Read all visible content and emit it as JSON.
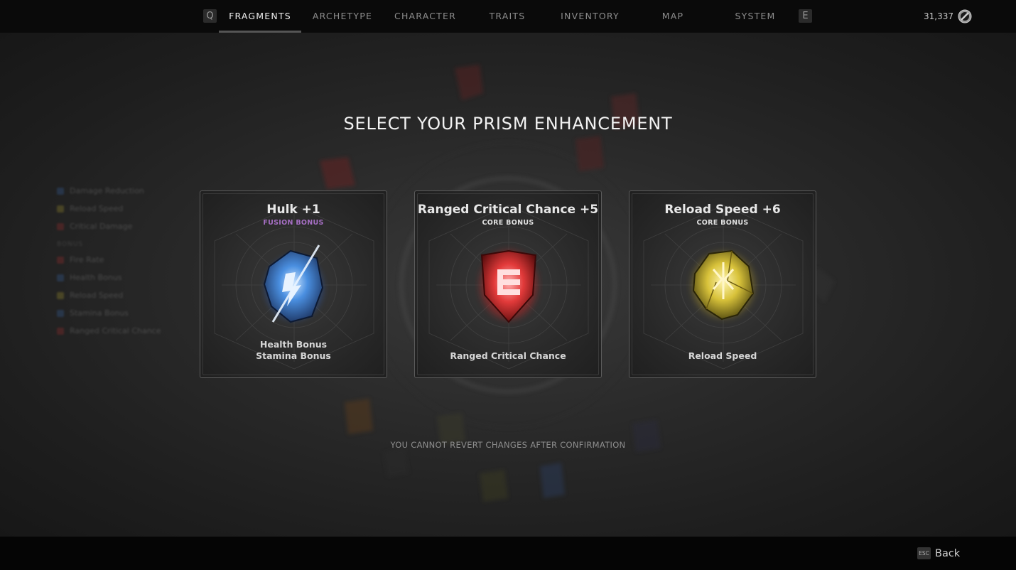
{
  "nav": {
    "left_key": "Q",
    "right_key": "E",
    "tabs": [
      {
        "label": "FRAGMENTS",
        "active": true
      },
      {
        "label": "ARCHETYPE",
        "active": false
      },
      {
        "label": "CHARACTER",
        "active": false
      },
      {
        "label": "TRAITS",
        "active": false
      },
      {
        "label": "INVENTORY",
        "active": false
      },
      {
        "label": "MAP",
        "active": false
      },
      {
        "label": "SYSTEM",
        "active": false
      }
    ],
    "currency": {
      "value": "31,337",
      "icon": "scrap-currency-icon"
    }
  },
  "main": {
    "heading": "SELECT YOUR PRISM ENHANCEMENT",
    "warning": "YOU CANNOT REVERT CHANGES AFTER CONFIRMATION",
    "cards": [
      {
        "title": "Hulk +1",
        "subtitle": "FUSION BONUS",
        "subtitle_color": "#a66fc4",
        "gem_icon": "blue-fusion-fragment-icon",
        "gem_color": "#4a8fe0",
        "stats": [
          "Health Bonus",
          "Stamina Bonus"
        ]
      },
      {
        "title": "Ranged Critical Chance +5",
        "subtitle": "CORE BONUS",
        "subtitle_color": "#e0e0e0",
        "gem_icon": "red-fragment-icon",
        "gem_color": "#e23a3a",
        "stats": [
          "Ranged Critical Chance"
        ]
      },
      {
        "title": "Reload Speed +6",
        "subtitle": "CORE BONUS",
        "subtitle_color": "#e0e0e0",
        "gem_icon": "yellow-fragment-icon",
        "gem_color": "#d8c23a",
        "stats": [
          "Reload Speed"
        ]
      }
    ]
  },
  "footer": {
    "back_key": "ESC",
    "back_label": "Back"
  },
  "colors": {
    "background": "#232323",
    "card_border": "#5b5b5b",
    "fusion_purple": "#a66fc4"
  }
}
